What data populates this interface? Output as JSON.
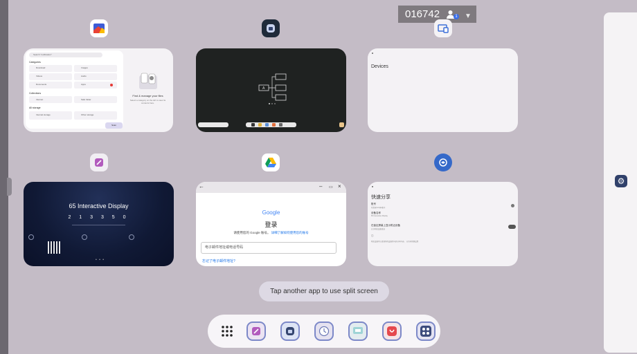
{
  "session": {
    "code": "016742",
    "user_count": "1"
  },
  "cards": {
    "files": {
      "search_placeholder": "Search \"notification\"",
      "categories_heading": "Categories",
      "categories": [
        {
          "name": "Download",
          "count": "10"
        },
        {
          "name": "Images",
          "count": "17"
        },
        {
          "name": "Videos",
          "count": "14"
        },
        {
          "name": "Audio",
          "count": "0"
        },
        {
          "name": "Documents",
          "count": "8"
        },
        {
          "name": "Apps",
          "count": "0"
        }
      ],
      "collections_heading": "Collections",
      "collections": [
        "Internet",
        "Safe folder"
      ],
      "storage_heading": "All storage",
      "storage": [
        "Internal storage",
        "Other storage"
      ],
      "empty_title": "Find & manage your files",
      "empty_sub": "Select a category on the left to view its contents here.",
      "fab_label": "Scan"
    },
    "devices": {
      "title": "Devices"
    },
    "display": {
      "title": "65 Interactive Display",
      "code": "2 1 3 3 5 0",
      "dots": "• • •"
    },
    "google": {
      "logo": "Google",
      "heading": "登录",
      "sub_prefix": "请使用您的 Google 账号。",
      "sub_link": "详细了解如何使用您的账号",
      "field_placeholder": "电子邮件地址或电话号码",
      "forgot": "忘记了电子邮件地址?"
    },
    "quickshare": {
      "title": "快速分享",
      "rows": [
        {
          "title": "账号",
          "sub": "已登录Google账号"
        },
        {
          "title": "设备名称",
          "sub": "65 Interactive Display"
        },
        {
          "title": "在锁定屏幕上显示附近设备",
          "sub": "允许附近设备发送"
        },
        {
          "title": "ⓘ",
          "sub": "附近设备可以发现你的设备并向其分享内容。 以访问管理设置"
        }
      ]
    }
  },
  "hint": "Tap another app to use split screen",
  "dock": [
    "app-drawer",
    "notes",
    "whiteboard",
    "clock",
    "screencast",
    "rcast",
    "apps-group"
  ],
  "colors": {
    "background": "#c4bcc6",
    "accent": "#3a6ee8"
  }
}
